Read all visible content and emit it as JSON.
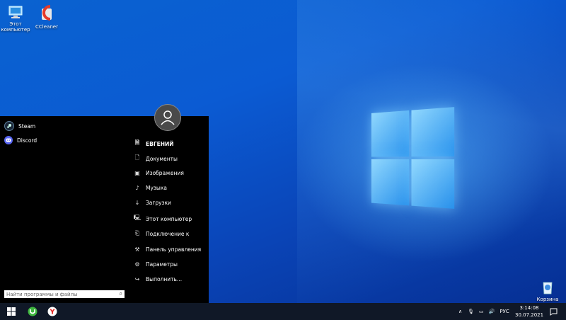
{
  "desktop": {
    "icons": [
      {
        "label": "Этот компьютер",
        "icon": "computer-icon"
      },
      {
        "label": "CCleaner",
        "icon": "ccleaner-icon"
      },
      {
        "label": "Корзина",
        "icon": "recycle-bin-icon"
      }
    ]
  },
  "start_menu": {
    "pinned": [
      {
        "label": "Steam",
        "icon": "steam-icon"
      },
      {
        "label": "Discord",
        "icon": "discord-icon"
      }
    ],
    "places": [
      {
        "label": "ЕВГЕНИЙ",
        "icon": "user-folder-icon"
      },
      {
        "label": "Документы",
        "icon": "documents-icon"
      },
      {
        "label": "Изображения",
        "icon": "pictures-icon"
      },
      {
        "label": "Музыка",
        "icon": "music-icon"
      },
      {
        "label": "Загрузки",
        "icon": "downloads-icon"
      },
      {
        "label": "Этот компьютер",
        "icon": "computer-icon"
      },
      {
        "label": "Подключение к",
        "icon": "connect-icon"
      },
      {
        "label": "Панель управления",
        "icon": "control-panel-icon"
      },
      {
        "label": "Параметры",
        "icon": "settings-icon"
      },
      {
        "label": "Выполнить...",
        "icon": "run-icon"
      }
    ],
    "search_placeholder": "Найти программы и файлы"
  },
  "taskbar": {
    "language": "РУС",
    "time": "3:14:08",
    "date": "30.07.2021"
  }
}
